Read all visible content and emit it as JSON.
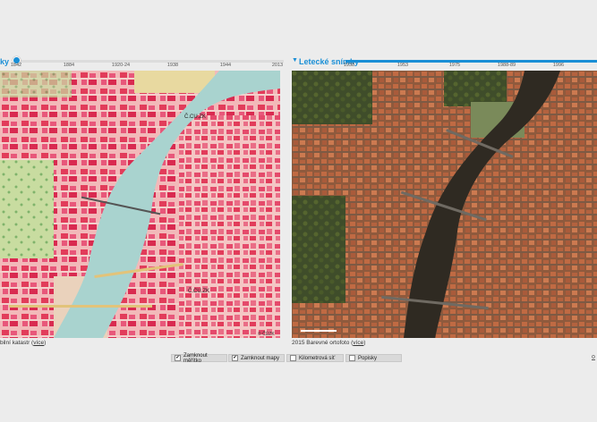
{
  "left_panel": {
    "timeline_label": "ky",
    "ticks": [
      "1842",
      "1884",
      "1920-24",
      "1938",
      "1944",
      "2013"
    ],
    "caption_text": "bilní katastr (",
    "caption_link": "více",
    "caption_end": ")",
    "map_labels": [
      "Č.CU.ZK",
      "Č.CU.ZK"
    ],
    "copyright": "© ČÚZK"
  },
  "right_panel": {
    "timeline_label": "Letecké snímky",
    "ticks": [
      "1938",
      "1953",
      "1975",
      "1988-89",
      "1996"
    ],
    "caption_text": "2015 Barevné ortofoto (",
    "caption_link": "více",
    "caption_end": ")"
  },
  "options": [
    {
      "label": "Zamknout měřítko",
      "checked": true
    },
    {
      "label": "Zamknout mapy",
      "checked": true
    },
    {
      "label": "Kilometrová síť",
      "checked": false
    },
    {
      "label": "Popisky",
      "checked": false
    }
  ],
  "colors": {
    "accent": "#1a8fd6",
    "river_left": "#a9d3cf",
    "river_right": "#2f2a22"
  }
}
